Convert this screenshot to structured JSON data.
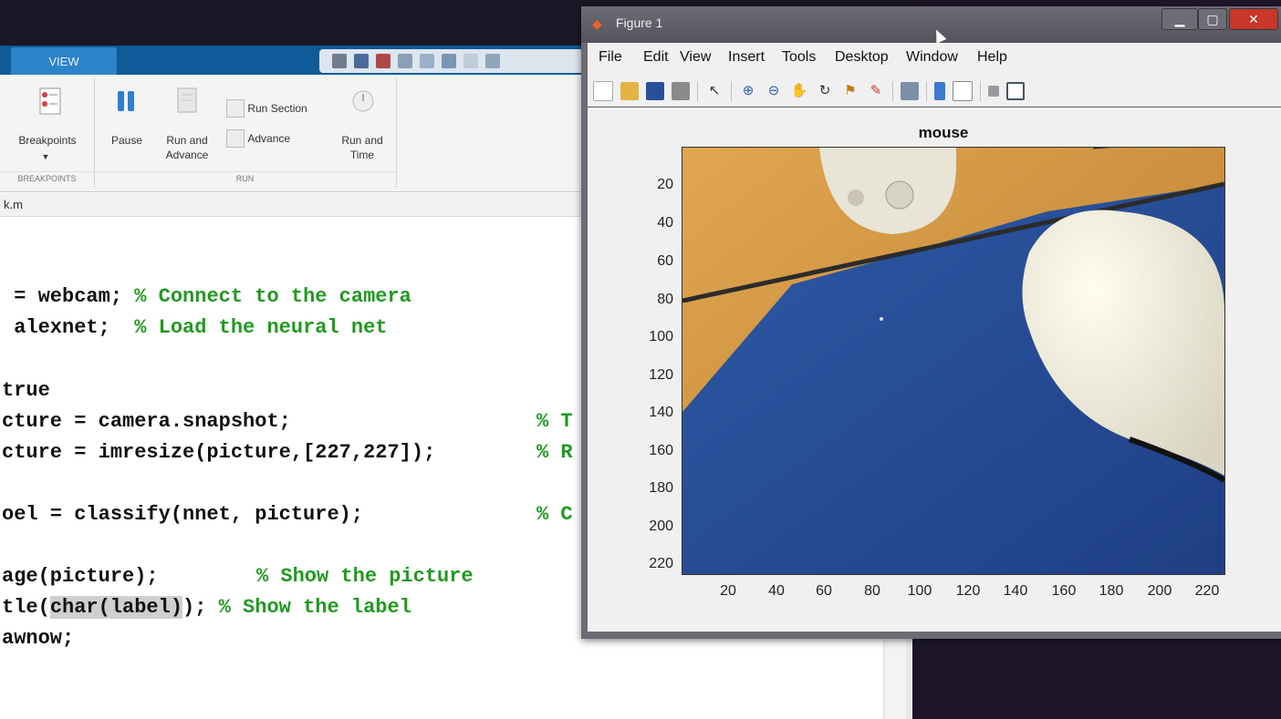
{
  "ribbon": {
    "tab_label": "VIEW",
    "buttons": {
      "breakpoints": "Breakpoints",
      "pause": "Pause",
      "run_and_advance": "Run and\nAdvance",
      "run_section": "Run Section",
      "advance": "Advance",
      "run_and_time": "Run and\nTime"
    },
    "groups": {
      "breakpoints": "BREAKPOINTS",
      "run": "RUN"
    }
  },
  "editor": {
    "file_tab": "k.m",
    "lines": [
      {
        "code": " = webcam; ",
        "comment": "% Connect to the camera"
      },
      {
        "code": " alexnet;  ",
        "comment": "% Load the neural net"
      },
      {
        "code": "true",
        "comment": ""
      },
      {
        "code": "cture = camera.snapshot;",
        "comment": "% T"
      },
      {
        "code": "cture = imresize(picture,[227,227]);",
        "comment": "% R"
      },
      {
        "code": "oel = classify(nnet, picture);",
        "comment": "% C"
      },
      {
        "code": "age(picture);",
        "comment": "% Show the picture"
      },
      {
        "code_pre": "tle(",
        "code_hl": "char(label)",
        "code_post": "); ",
        "comment": "% Show the label"
      },
      {
        "code": "awnow;",
        "comment": ""
      }
    ]
  },
  "figure": {
    "window_title": "Figure 1",
    "menu": [
      "File",
      "Edit",
      "View",
      "Insert",
      "Tools",
      "Desktop",
      "Window",
      "Help"
    ],
    "axes_title": "mouse",
    "y_ticks": [
      "20",
      "40",
      "60",
      "80",
      "100",
      "120",
      "140",
      "160",
      "180",
      "200",
      "220"
    ],
    "x_ticks": [
      "20",
      "40",
      "60",
      "80",
      "100",
      "120",
      "140",
      "160",
      "180",
      "200",
      "220"
    ]
  },
  "colors": {
    "ribbon_blue": "#0f5a98",
    "comment_green": "#1f9a1f",
    "close_red": "#c9362a"
  }
}
